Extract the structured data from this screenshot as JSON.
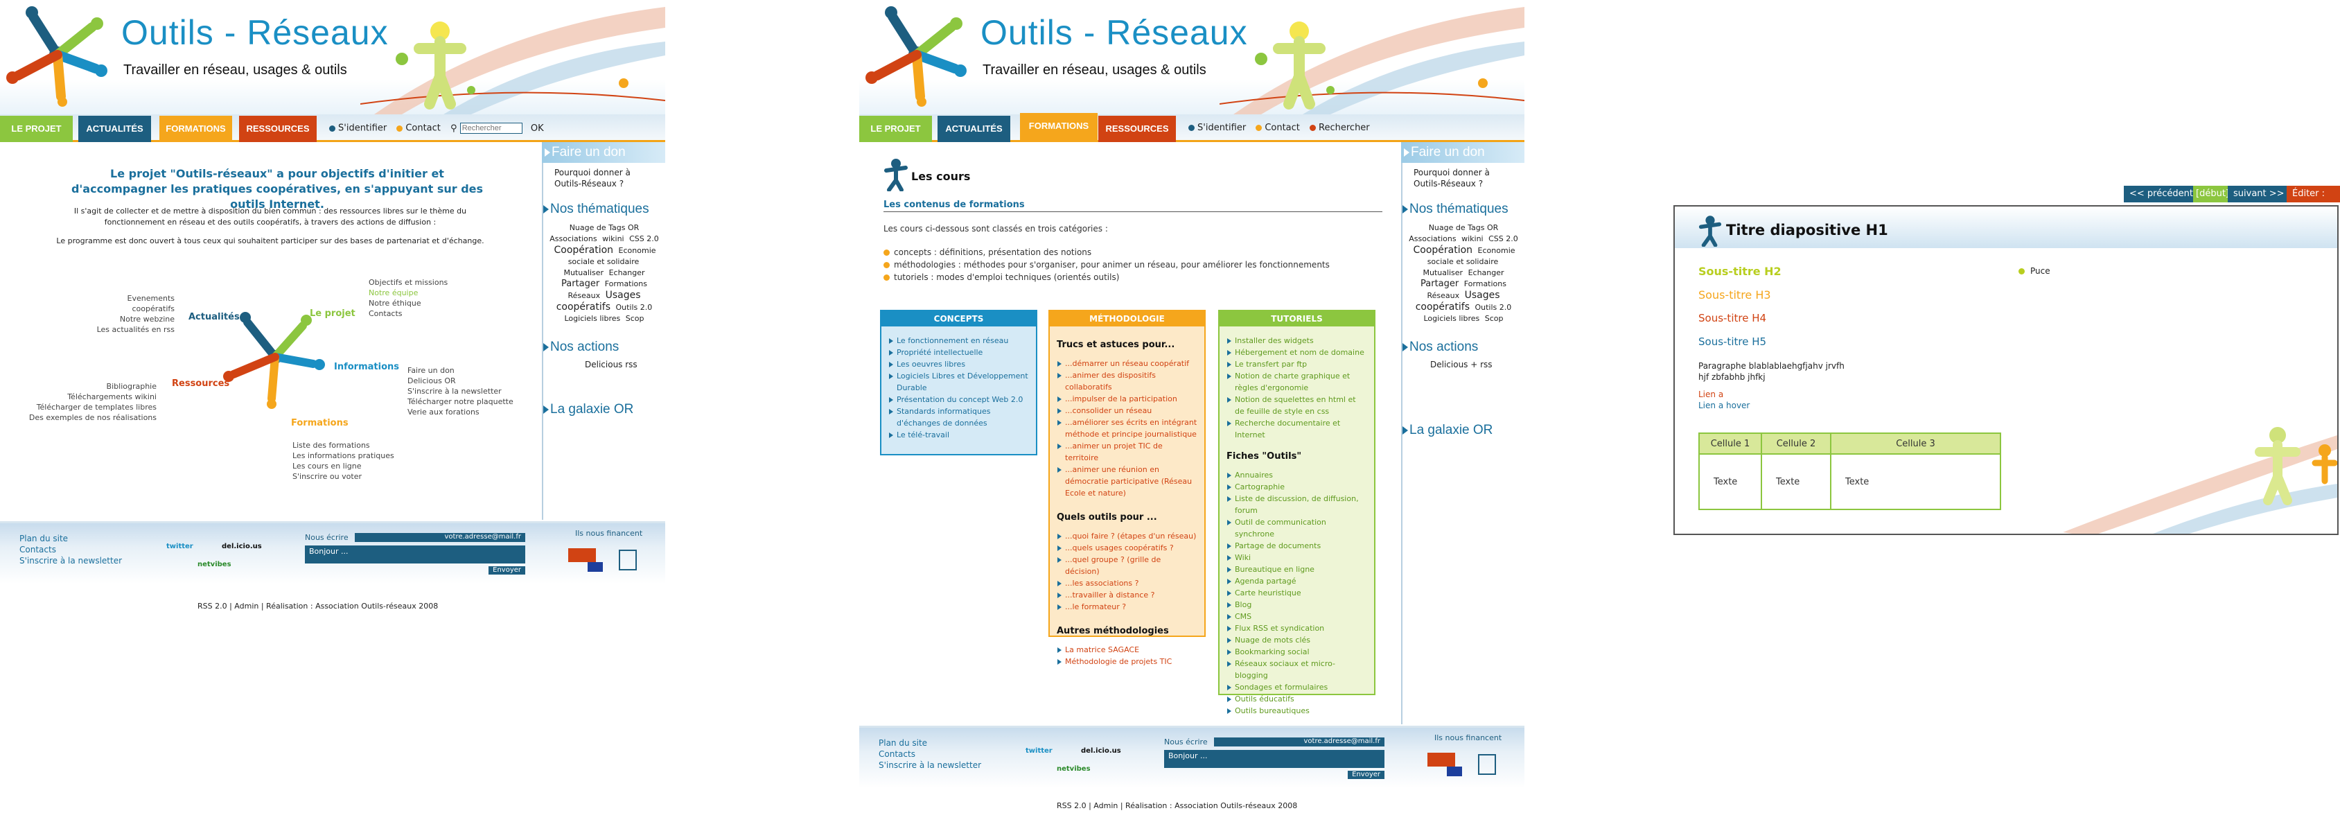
{
  "site": {
    "title": "Outils - Réseaux",
    "tagline": "Travailler en réseau, usages & outils"
  },
  "nav": {
    "tabs": [
      "LE PROJET",
      "ACTUALITÉS",
      "FORMATIONS",
      "RESSOURCES"
    ],
    "login": "S'identifier",
    "contact": "Contact",
    "search_placeholder": "Rechercher",
    "search_button": "OK",
    "search_link": "Rechercher"
  },
  "sidebar": {
    "don_title": "Faire un don",
    "don_text": "Pourquoi donner à Outils-Réseaux ?",
    "themes_title": "Nos thématiques",
    "tags": [
      "Nuage de Tags OR",
      "Associations",
      "wikini",
      "CSS 2.0",
      "Coopération",
      "Economie sociale et solidaire",
      "Mutualiser",
      "Echanger",
      "Partager",
      "Formations",
      "Réseaux",
      "Usages",
      "coopératifs",
      "Outils 2.0",
      "Logiciels libres",
      "Scop"
    ],
    "actions_title": "Nos actions",
    "actions_text": "Delicious rss",
    "actions_text_p2": "Delicious + rss",
    "galaxie_title": "La galaxie OR"
  },
  "page1": {
    "lead": "Le projet \"Outils-réseaux\" a pour objectifs d'initier et d'accompagner les pratiques coopératives, en s'appuyant sur des outils Internet.",
    "p1": "Il s'agit de collecter et de mettre à disposition du bien commun : des ressources libres sur le thème du fonctionnement en réseau et des outils coopératifs, à travers des actions de diffusion :",
    "p2": "Le programme est donc ouvert à tous ceux qui souhaitent participer sur des bases de partenariat et d'échange.",
    "diagram": {
      "projet_label": "Le projet",
      "projet_items": [
        "Objectifs et missions",
        "Notre équipe",
        "Notre éthique",
        "Contacts"
      ],
      "actu_label": "Actualités",
      "actu_items": [
        "Evenements coopératifs",
        "Notre webzine",
        "Les actualités en rss"
      ],
      "info_label": "Informations",
      "info_items": [
        "Faire un don",
        "Delicious OR",
        "S'inscrire à la newsletter",
        "Télécharger notre plaquette",
        "Verie aux forations"
      ],
      "res_label": "Ressources",
      "res_items": [
        "Bibliographie",
        "Téléchargements wikini",
        "Télécharger de templates libres",
        "Des exemples de nos réalisations"
      ],
      "form_label": "Formations",
      "form_items": [
        "Liste des formations",
        "Les informations pratiques",
        "Les cours en ligne",
        "S'inscrire ou voter"
      ]
    }
  },
  "footer": {
    "links": [
      "Plan du site",
      "Contacts",
      "S'inscrire à la newsletter"
    ],
    "badges": [
      "twitter",
      "del.icio.us",
      "netvibes"
    ],
    "newsletter_label": "Nous écrire",
    "newsletter_email": "votre.adresse@mail.fr",
    "newsletter_text": "Bonjour ...",
    "newsletter_button": "Envoyer",
    "funders": "Ils nous financent",
    "credits": "RSS 2.0   |   Admin   |   Réalisation : Association Outils-réseaux 2008"
  },
  "page2": {
    "title": "Les cours",
    "h2": "Les contenus de formations",
    "intro": "Les cours ci-dessous sont classés en trois catégories :",
    "categories": [
      "concepts : définitions, présentation des notions",
      "méthodologies : méthodes pour s'organiser, pour animer un réseau, pour améliorer les fonctionnements",
      "tutoriels : modes d'emploi techniques (orientés outils)"
    ],
    "concepts": {
      "head": "CONCEPTS",
      "items": [
        "Le fonctionnement en réseau",
        "Propriété intellectuelle",
        "Les oeuvres libres",
        "Logiciels Libres et Développement Durable",
        "Présentation du concept Web 2.0",
        "Standards informatiques d'échanges de données",
        "Le télé-travail"
      ]
    },
    "methodologie": {
      "head": "MÉTHODOLOGIE",
      "sub1": "Trucs et astuces pour...",
      "items1": [
        "...démarrer un réseau coopératif",
        "...animer des dispositifs collaboratifs",
        "...impulser de la participation",
        "...consolider un réseau",
        "...améliorer ses écrits en intégrant méthode et principe journalistique",
        "...animer un projet TIC de territoire",
        "...animer une réunion en démocratie participative (Réseau Ecole et nature)"
      ],
      "sub2": "Quels outils pour ...",
      "items2": [
        "...quoi faire ? (étapes d'un réseau)",
        "...quels usages coopératifs ?",
        "...quel groupe ? (grille de décision)",
        "...les associations ?",
        "...travailler à distance ?",
        "...le formateur ?"
      ],
      "sub3": "Autres méthodologies",
      "items3": [
        "La matrice SAGACE",
        "Méthodologie de projets TIC"
      ]
    },
    "tutoriels": {
      "head": "TUTORIELS",
      "items1": [
        "Installer des widgets",
        "Hébergement et nom de domaine",
        "Le transfert par ftp",
        "Notion de charte graphique et règles d'ergonomie",
        "Notion de squelettes en html et de feuille de style en css",
        "Recherche documentaire et Internet"
      ],
      "sub": "Fiches \"Outils\"",
      "items2": [
        "Annuaires",
        "Cartographie",
        "Liste de discussion, de diffusion, forum",
        "Outil de communication synchrone",
        "Partage de documents",
        "Wiki",
        "Bureautique en ligne",
        "Agenda partagé",
        "Carte heuristique",
        "Blog",
        "CMS",
        "Flux RSS et syndication",
        "Nuage de mots clés",
        "Bookmarking social",
        "Réseaux sociaux et micro-blogging",
        "Sondages et formulaires",
        "Outils éducatifs",
        "Outils bureautiques"
      ]
    }
  },
  "page3": {
    "prev": "<< précédent",
    "debut": "[début]",
    "next": "suivant >>",
    "edit": "Éditer : [l]->",
    "title": "Titre diapositive H1",
    "h2": "Sous-titre H2",
    "h3": "Sous-titre H3",
    "h4": "Sous-titre H4",
    "h5": "Sous-titre H5",
    "paragraph": "Paragraphe blablablaehgfjahv jrvfh hjf zbfabhb jhfkj",
    "link": "Lien a",
    "link_hover": "Lien a hover",
    "bullet": "Puce",
    "table_headers": [
      "Cellule 1",
      "Cellule 2",
      "Cellule 3"
    ],
    "table_cells": [
      "Texte",
      "Texte",
      "Texte"
    ]
  },
  "colors": {
    "green": "#8cc63f",
    "blue": "#1d5e80",
    "orange": "#f5a61c",
    "red": "#d14313",
    "link": "#1a6f9c"
  }
}
